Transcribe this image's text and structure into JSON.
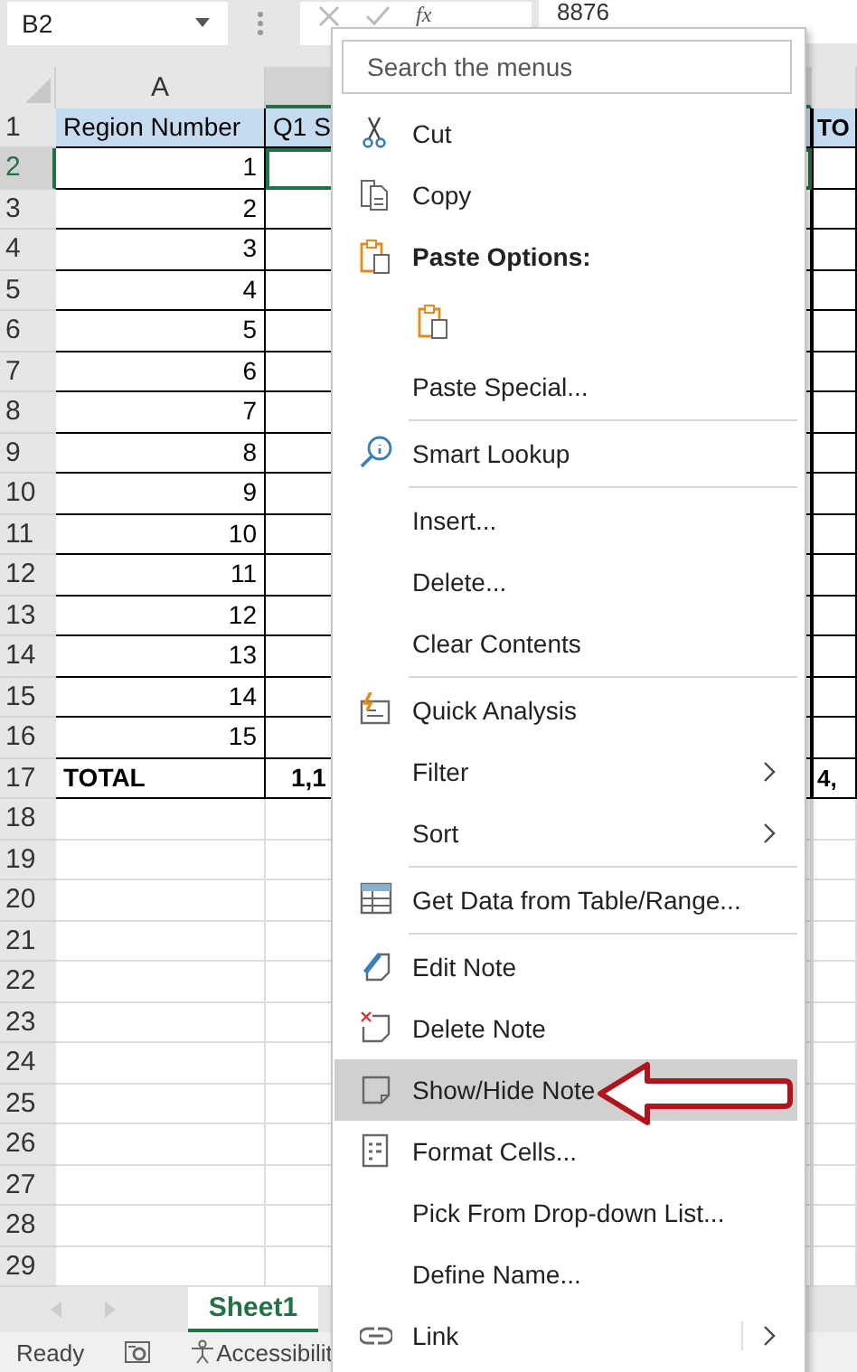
{
  "name_box": "B2",
  "formula": {
    "function_label": "fx",
    "value": "8876"
  },
  "column_headers": [
    {
      "label": "A",
      "selected": false
    },
    {
      "selected": true
    }
  ],
  "rows": [
    {
      "number": "1",
      "kind": "header",
      "selected": false,
      "a": "Region Number",
      "b": "Q1 S",
      "c": "TO"
    },
    {
      "number": "2",
      "kind": "data",
      "selected": true,
      "a": "1"
    },
    {
      "number": "3",
      "kind": "data",
      "selected": false,
      "a": "2"
    },
    {
      "number": "4",
      "kind": "data",
      "selected": false,
      "a": "3"
    },
    {
      "number": "5",
      "kind": "data",
      "selected": false,
      "a": "4"
    },
    {
      "number": "6",
      "kind": "data",
      "selected": false,
      "a": "5"
    },
    {
      "number": "7",
      "kind": "data",
      "selected": false,
      "a": "6"
    },
    {
      "number": "8",
      "kind": "data",
      "selected": false,
      "a": "7"
    },
    {
      "number": "9",
      "kind": "data",
      "selected": false,
      "a": "8"
    },
    {
      "number": "10",
      "kind": "data",
      "selected": false,
      "a": "9"
    },
    {
      "number": "11",
      "kind": "data",
      "selected": false,
      "a": "10"
    },
    {
      "number": "12",
      "kind": "data",
      "selected": false,
      "a": "11"
    },
    {
      "number": "13",
      "kind": "data",
      "selected": false,
      "a": "12"
    },
    {
      "number": "14",
      "kind": "data",
      "selected": false,
      "a": "13"
    },
    {
      "number": "15",
      "kind": "data",
      "selected": false,
      "a": "14"
    },
    {
      "number": "16",
      "kind": "data",
      "selected": false,
      "a": "15"
    },
    {
      "number": "17",
      "kind": "total",
      "selected": false,
      "a": "TOTAL",
      "b": "1,1",
      "c": "4,"
    },
    {
      "number": "18",
      "kind": "empty",
      "selected": false
    },
    {
      "number": "19",
      "kind": "empty",
      "selected": false
    },
    {
      "number": "20",
      "kind": "empty",
      "selected": false
    },
    {
      "number": "21",
      "kind": "empty",
      "selected": false
    },
    {
      "number": "22",
      "kind": "empty",
      "selected": false
    },
    {
      "number": "23",
      "kind": "empty",
      "selected": false
    },
    {
      "number": "24",
      "kind": "empty",
      "selected": false
    },
    {
      "number": "25",
      "kind": "empty",
      "selected": false
    },
    {
      "number": "26",
      "kind": "empty",
      "selected": false
    },
    {
      "number": "27",
      "kind": "empty",
      "selected": false
    },
    {
      "number": "28",
      "kind": "empty",
      "selected": false
    },
    {
      "number": "29",
      "kind": "empty",
      "selected": false
    }
  ],
  "sheet_tabs": [
    {
      "label": "Sheet1",
      "selected": true
    }
  ],
  "status_bar": {
    "text": "Ready",
    "accessibility": "Accessibilit"
  },
  "context_menu": {
    "search": {
      "placeholder": "Search the menus"
    },
    "items": [
      {
        "kind": "item",
        "label": "Cut",
        "separator_before": false,
        "submenu": false,
        "selected": false
      },
      {
        "kind": "item",
        "label": "Copy",
        "separator_before": false,
        "submenu": false,
        "selected": false
      },
      {
        "kind": "header",
        "label": "Paste Options:",
        "separator_before": false,
        "submenu": false,
        "selected": false
      },
      {
        "kind": "paste-option",
        "separator_before": false,
        "submenu": false,
        "selected": false
      },
      {
        "kind": "item",
        "label": "Paste Special...",
        "separator_before": false,
        "submenu": false,
        "selected": false
      },
      {
        "kind": "item",
        "label": "Smart Lookup",
        "separator_before": true,
        "submenu": false,
        "selected": false
      },
      {
        "kind": "item",
        "label": "Insert...",
        "separator_before": true,
        "submenu": false,
        "selected": false
      },
      {
        "kind": "item",
        "label": "Delete...",
        "separator_before": false,
        "submenu": false,
        "selected": false
      },
      {
        "kind": "item",
        "label": "Clear Contents",
        "separator_before": false,
        "submenu": false,
        "selected": false
      },
      {
        "kind": "item",
        "label": "Quick Analysis",
        "separator_before": true,
        "submenu": false,
        "selected": false
      },
      {
        "kind": "item",
        "label": "Filter",
        "separator_before": false,
        "submenu": true,
        "selected": false
      },
      {
        "kind": "item",
        "label": "Sort",
        "separator_before": false,
        "submenu": true,
        "selected": false
      },
      {
        "kind": "item",
        "label": "Get Data from Table/Range...",
        "separator_before": true,
        "submenu": false,
        "selected": false
      },
      {
        "kind": "item",
        "label": "Edit Note",
        "separator_before": true,
        "submenu": false,
        "selected": false
      },
      {
        "kind": "item",
        "label": "Delete Note",
        "separator_before": false,
        "submenu": false,
        "selected": false
      },
      {
        "kind": "item",
        "label": "Show/Hide Note",
        "separator_before": false,
        "submenu": false,
        "selected": true
      },
      {
        "kind": "item",
        "label": "Format Cells...",
        "separator_before": false,
        "submenu": false,
        "selected": false
      },
      {
        "kind": "item",
        "label": "Pick From Drop-down List...",
        "separator_before": false,
        "submenu": false,
        "selected": false
      },
      {
        "kind": "item",
        "label": "Define Name...",
        "separator_before": false,
        "submenu": false,
        "selected": false
      },
      {
        "kind": "split",
        "label": "Link",
        "separator_before": false,
        "submenu": true,
        "selected": false
      }
    ]
  }
}
